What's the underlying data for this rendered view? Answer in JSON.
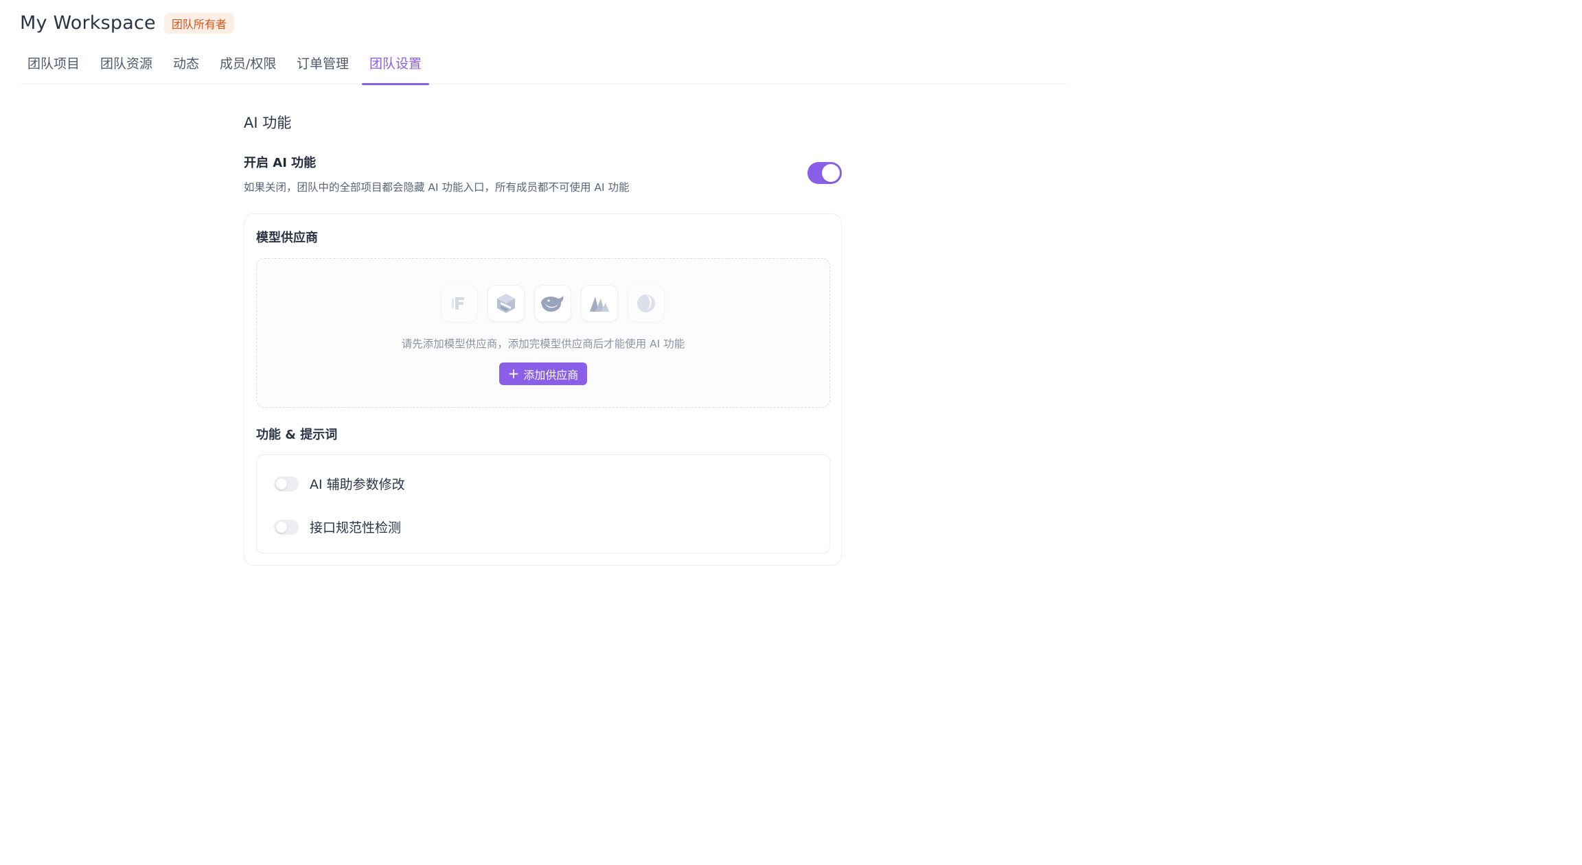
{
  "workspace": {
    "title": "My Workspace",
    "role_badge": "团队所有者"
  },
  "tabs": [
    {
      "label": "团队项目",
      "active": false
    },
    {
      "label": "团队资源",
      "active": false
    },
    {
      "label": "动态",
      "active": false
    },
    {
      "label": "成员/权限",
      "active": false
    },
    {
      "label": "订单管理",
      "active": false
    },
    {
      "label": "团队设置",
      "active": true
    }
  ],
  "ai": {
    "section_title": "AI 功能",
    "enable_title": "开启 AI 功能",
    "enable_desc": "如果关闭，团队中的全部项目都会隐藏 AI 功能入口，所有成员都不可使用 AI 功能",
    "enabled": true
  },
  "providers": {
    "heading": "模型供应商",
    "logos": [
      "fireworks-logo-icon",
      "claude-box-logo-icon",
      "deepseek-whale-logo-icon",
      "mountain-logo-icon",
      "moon-logo-icon"
    ],
    "empty_text": "请先添加模型供应商，添加完模型供应商后才能使用 AI 功能",
    "add_label": "添加供应商"
  },
  "features": {
    "heading": "功能 & 提示词",
    "items": [
      {
        "label": "AI 辅助参数修改",
        "enabled": false
      },
      {
        "label": "接口规范性检测",
        "enabled": false
      }
    ]
  },
  "colors": {
    "accent": "#8a5fe8",
    "badge_bg": "#fdeee6",
    "badge_text": "#d4561d"
  }
}
